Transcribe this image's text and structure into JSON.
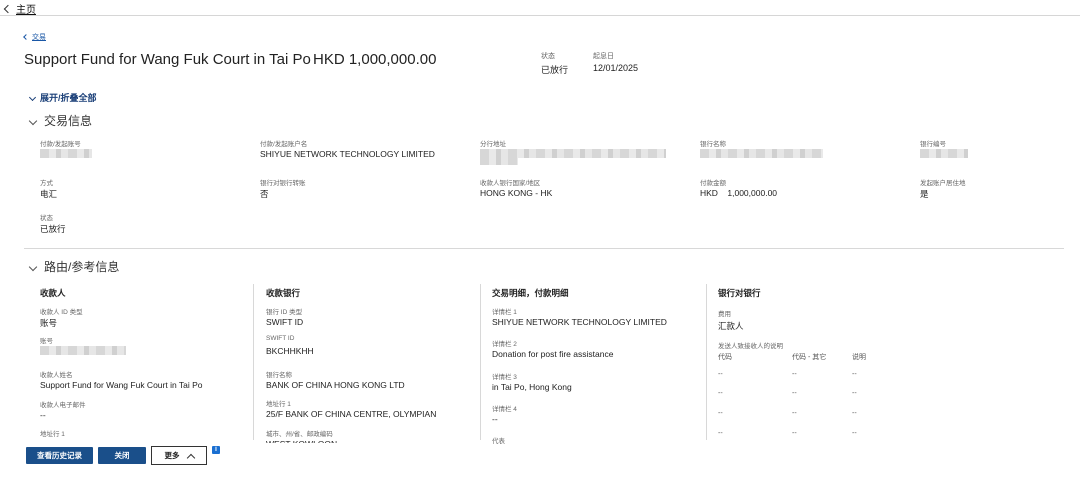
{
  "nav": {
    "back_label": "主页",
    "crumb_label": "交易"
  },
  "header": {
    "title": "Support Fund for Wang Fuk Court in Tai Po",
    "amount": "HKD 1,000,000.00",
    "status_label": "状态",
    "status_value": "已放行",
    "date_label": "起息日",
    "date_value": "12/01/2025"
  },
  "expand_all_label": "展开/折叠全部",
  "transaction_info": {
    "title": "交易信息",
    "fields": [
      {
        "label": "付款/发起账号",
        "value": ""
      },
      {
        "label": "付款/发起账户名",
        "value": "SHIYUE NETWORK TECHNOLOGY LIMITED"
      },
      {
        "label": "分行地址",
        "value": ""
      },
      {
        "label": "银行名称",
        "value": ""
      },
      {
        "label": "银行编号",
        "value": ""
      },
      {
        "label": "方式",
        "value": "电汇"
      },
      {
        "label": "银行对银行转账",
        "value": "否"
      },
      {
        "label": "收款人银行国家/地区",
        "value": "HONG KONG - HK"
      },
      {
        "label": "付款金额",
        "value": "HKD    1,000,000.00"
      },
      {
        "label": "发起账户居住地",
        "value": "是"
      },
      {
        "label": "状态",
        "value": "已放行"
      }
    ]
  },
  "routing": {
    "title": "路由/参考信息",
    "payee": {
      "heading": "收款人",
      "id_type_label": "收款人 ID 类型",
      "id_type_value": "账号",
      "account_label": "账号",
      "name_label": "收款人姓名",
      "name_value": "Support Fund for Wang Fuk Court in Tai Po",
      "email_label": "收款人电子邮件",
      "email_value": "--",
      "address_label": "地址行 1"
    },
    "payee_bank": {
      "heading": "收款银行",
      "id_type_label": "银行 ID 类型",
      "id_type_value": "SWIFT ID",
      "swift_label": "SWIFT ID",
      "swift_value": "BKCHHKHH",
      "name_label": "银行名称",
      "name_value": "BANK OF CHINA HONG KONG LTD",
      "address_label": "地址行 1",
      "address_value": "25/F BANK OF CHINA CENTRE, OLYMPIAN",
      "city_label": "城市、州/省、邮政编码",
      "city_value": "WEST KOWLOON"
    },
    "details": {
      "heading": "交易明细，付款明细",
      "d1_label": "详情栏 1",
      "d1_value": "SHIYUE NETWORK TECHNOLOGY LIMITED",
      "d2_label": "详情栏 2",
      "d2_value": "Donation for post fire assistance",
      "d3_label": "详情栏 3",
      "d3_value": "in Tai Po, Hong Kong",
      "d4_label": "详情栏 4",
      "d4_value": "--",
      "agent_label": "代表"
    },
    "b2b": {
      "heading": "银行对银行",
      "fee_label": "费用",
      "fee_value": "汇款人",
      "note_label": "发送人致接收人的说明",
      "columns": [
        "代码",
        "代码 - 其它",
        "说明"
      ],
      "rows": [
        [
          "--",
          "--",
          "--"
        ],
        [
          "--",
          "--",
          "--"
        ],
        [
          "--",
          "--",
          "--"
        ],
        [
          "--",
          "--",
          "--"
        ]
      ]
    }
  },
  "buttons": {
    "history": "查看历史记录",
    "close": "关闭",
    "more": "更多"
  },
  "info_icon_glyph": "i"
}
